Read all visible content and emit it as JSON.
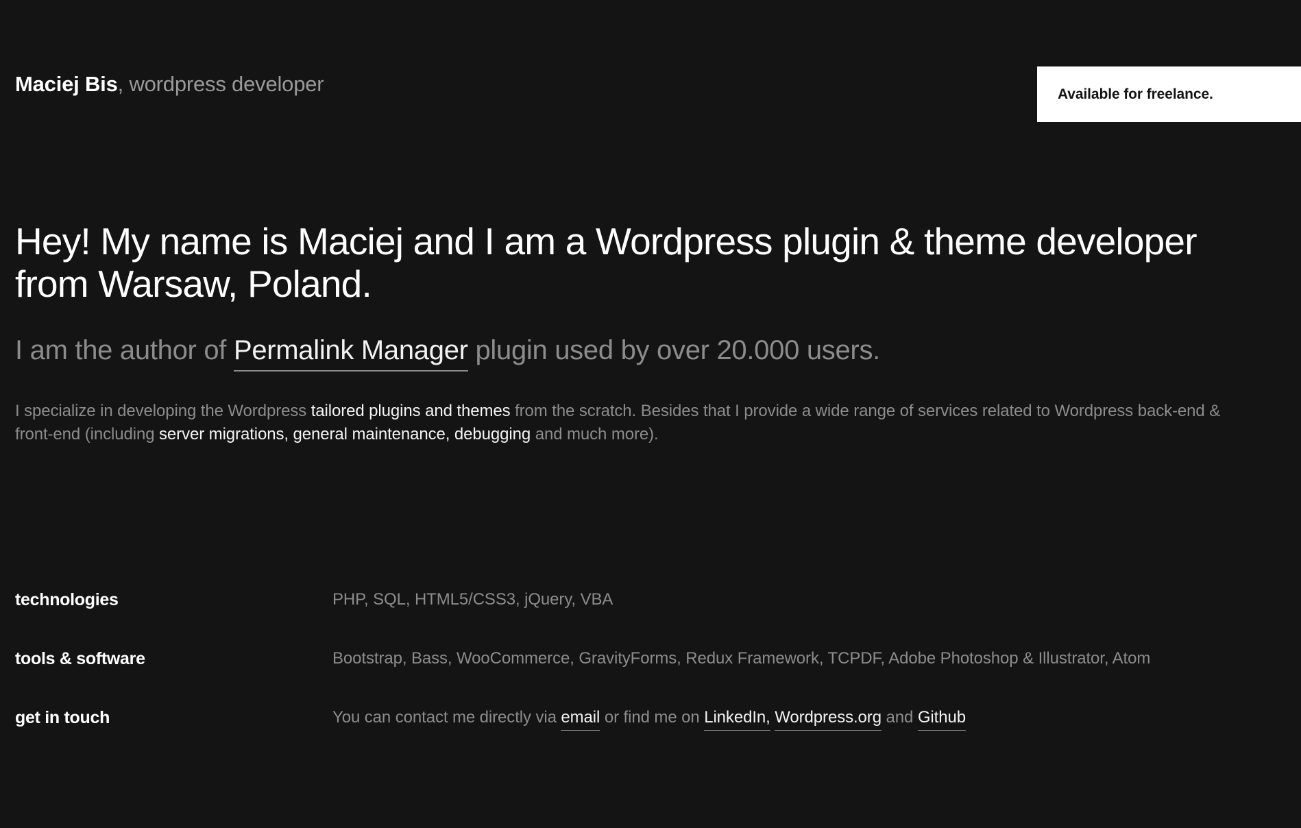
{
  "header": {
    "brand_name": "Maciej Bis",
    "brand_role": ", wordpress developer",
    "availability_label": "Available for freelance."
  },
  "hero": {
    "title": "Hey! My name is Maciej and I am a Wordpress plugin & theme developer from Warsaw, Poland.",
    "subtitle_before": "I am the author of ",
    "subtitle_link": "Permalink Manager",
    "subtitle_after": " plugin used by over 20.000 users.",
    "paragraph_1": "I specialize in developing the Wordpress ",
    "paragraph_hl_1": "tailored plugins and themes",
    "paragraph_2": " from the scratch. Besides that I provide a wide range of services related to Wordpress back-end & front-end (including ",
    "paragraph_hl_2": "server migrations, general maintenance, debugging",
    "paragraph_3": " and much more)."
  },
  "info": {
    "rows": [
      {
        "label": "technologies",
        "value": "PHP, SQL, HTML5/CSS3, jQuery, VBA"
      },
      {
        "label": "tools & software",
        "value": "Bootstrap, Bass, WooCommerce, GravityForms, Redux Framework, TCPDF, Adobe Photoshop & Illustrator, Atom"
      },
      {
        "label": "get in touch",
        "contact_before": "You can contact me directly via ",
        "contact_email": "email",
        "contact_mid": " or find me on ",
        "contact_linkedin": "LinkedIn,",
        "contact_space_1": " ",
        "contact_wordpress": "Wordpress.org",
        "contact_and": " and ",
        "contact_github": "Github"
      }
    ]
  },
  "colors": {
    "background": "#141414",
    "text_primary": "#ffffff",
    "text_muted": "#8c8c8c",
    "badge_background": "#ffffff",
    "badge_text": "#141414"
  }
}
